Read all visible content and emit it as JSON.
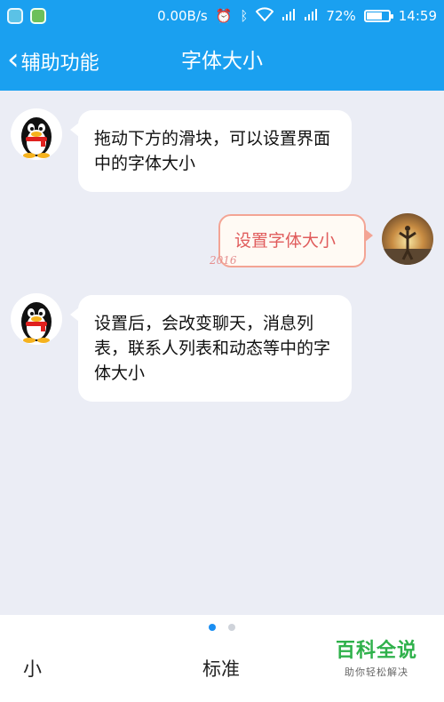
{
  "status_bar": {
    "network_speed": "0.00B/s",
    "battery": "72%",
    "battery_level": 0.72,
    "time": "14:59",
    "icons": [
      "alarm-icon",
      "bluetooth-icon",
      "wifi-icon",
      "signal-icon",
      "signal-icon"
    ]
  },
  "nav": {
    "back_label": "辅助功能",
    "title": "字体大小"
  },
  "chat": {
    "messages": [
      {
        "side": "left",
        "text": "拖动下方的滑块，可以设置界面中的字体大小"
      },
      {
        "side": "right",
        "text": "设置字体大小"
      },
      {
        "side": "left",
        "text": "设置后，会改变聊天，消息列表，联系人列表和动态等中的字体大小"
      }
    ]
  },
  "bottom": {
    "page_indicator": {
      "count": 2,
      "active": 1
    },
    "size_small": "小",
    "size_standard": "标准"
  },
  "watermark": {
    "main": "百科全说",
    "sub": "助你轻松解决"
  },
  "colors": {
    "primary": "#1aa0f0",
    "background": "#ebedf5",
    "right_bubble_text": "#e05c5c",
    "watermark": "#2fb14b"
  }
}
